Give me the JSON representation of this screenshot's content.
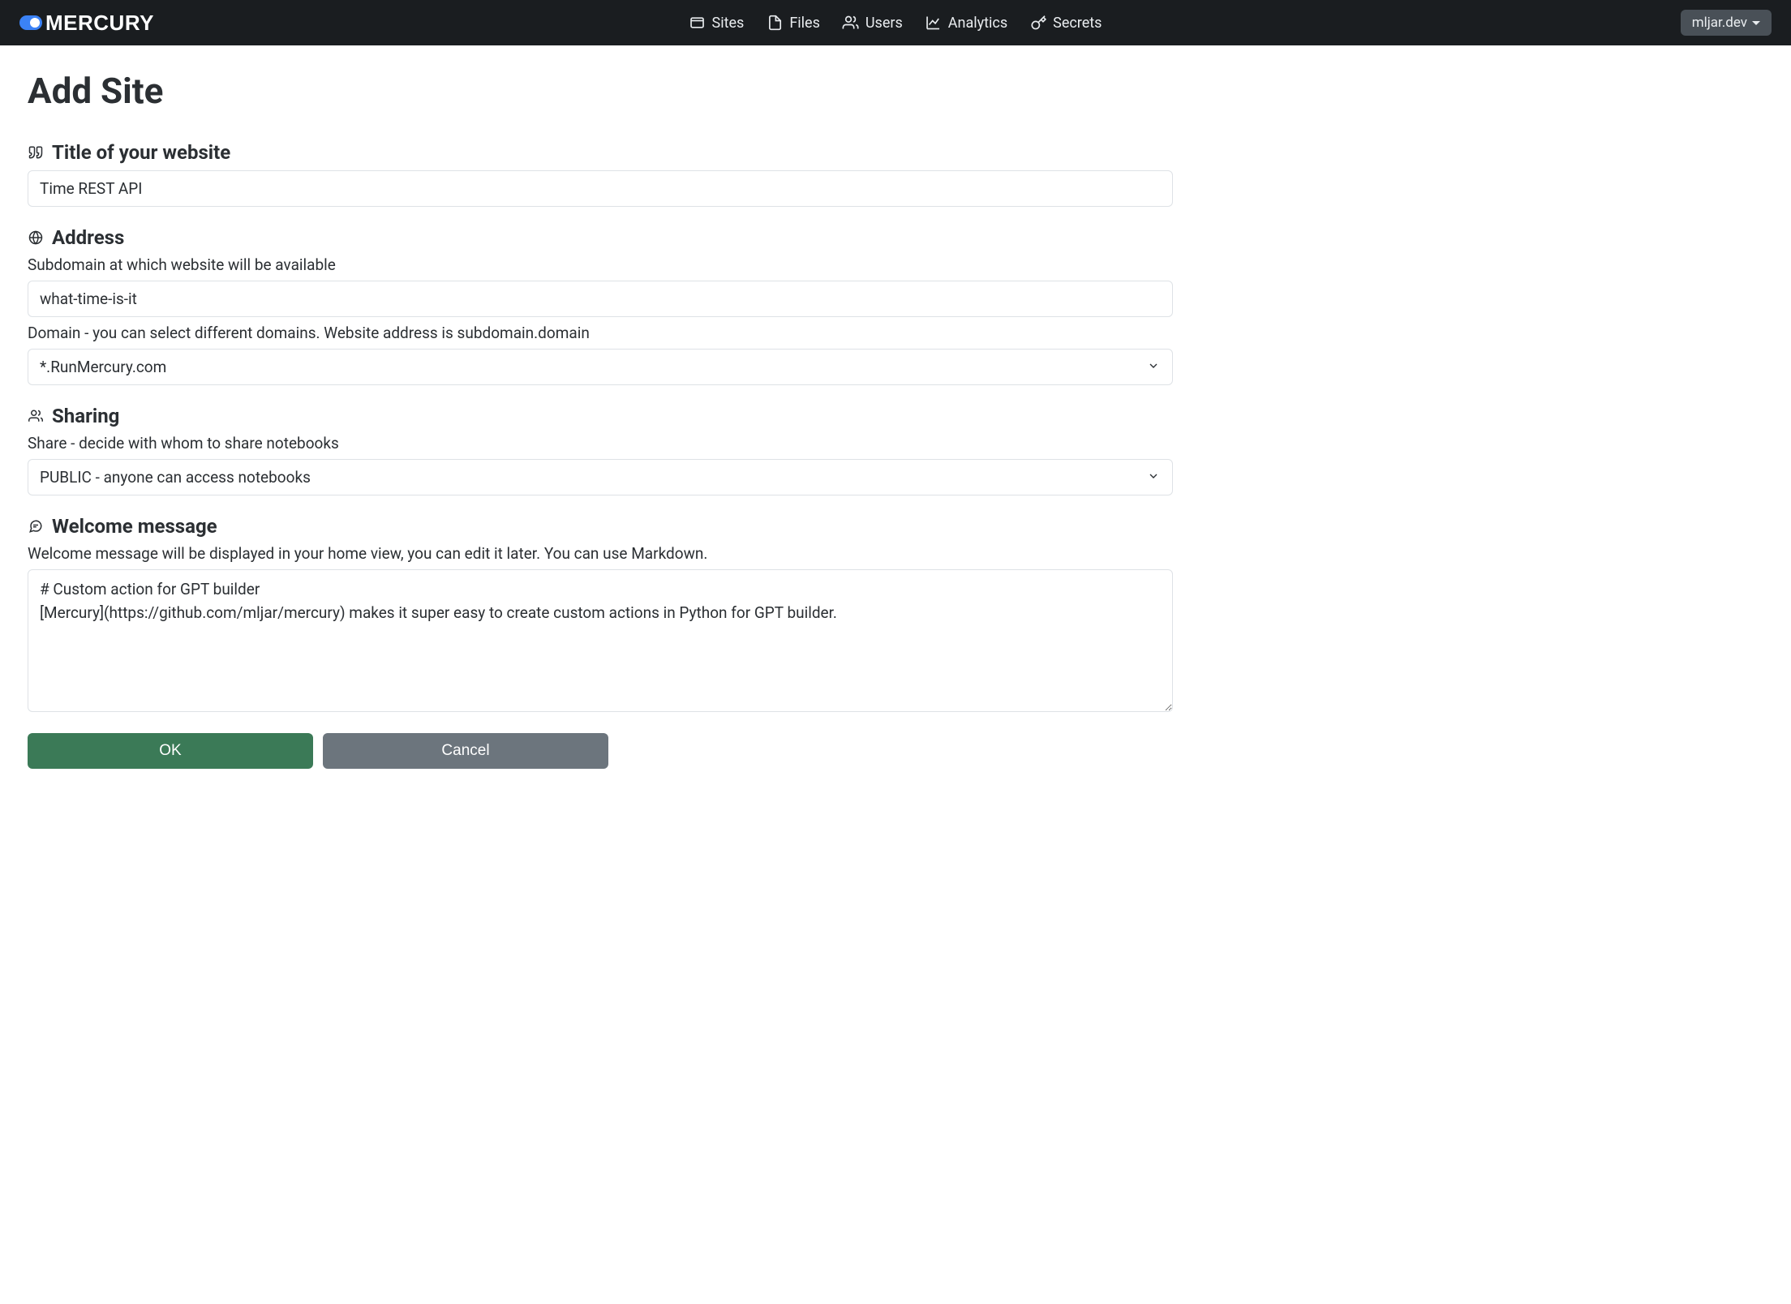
{
  "header": {
    "logo_text": "MERCURY",
    "nav": {
      "sites": "Sites",
      "files": "Files",
      "users": "Users",
      "analytics": "Analytics",
      "secrets": "Secrets"
    },
    "user": "mljar.dev"
  },
  "page": {
    "title": "Add Site"
  },
  "form": {
    "title_section": {
      "label": "Title of your website",
      "value": "Time REST API"
    },
    "address_section": {
      "label": "Address",
      "subdomain_help": "Subdomain at which website will be available",
      "subdomain_value": "what-time-is-it",
      "domain_help": "Domain - you can select different domains. Website address is subdomain.domain",
      "domain_value": "*.RunMercury.com"
    },
    "sharing_section": {
      "label": "Sharing",
      "share_help": "Share - decide with whom to share notebooks",
      "share_value": "PUBLIC - anyone can access notebooks"
    },
    "welcome_section": {
      "label": "Welcome message",
      "welcome_help": "Welcome message will be displayed in your home view, you can edit it later. You can use Markdown.",
      "welcome_value": "# Custom action for GPT builder\n[Mercury](https://github.com/mljar/mercury) makes it super easy to create custom actions in Python for GPT builder."
    },
    "buttons": {
      "ok": "OK",
      "cancel": "Cancel"
    }
  }
}
